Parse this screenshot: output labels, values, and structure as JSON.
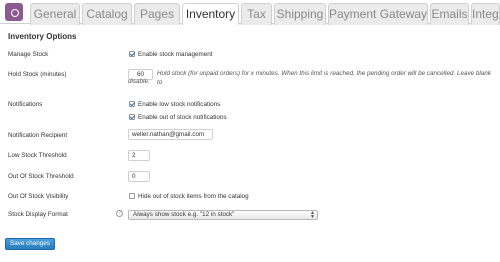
{
  "tabs": [
    {
      "label": "General",
      "active": false
    },
    {
      "label": "Catalog",
      "active": false
    },
    {
      "label": "Pages",
      "active": false
    },
    {
      "label": "Inventory",
      "active": true
    },
    {
      "label": "Tax",
      "active": false
    },
    {
      "label": "Shipping",
      "active": false
    },
    {
      "label": "Payment Gateways",
      "active": false
    },
    {
      "label": "Emails",
      "active": false
    },
    {
      "label": "Integration",
      "active": false
    }
  ],
  "section_title": "Inventory Options",
  "manage_stock": {
    "label": "Manage Stock",
    "checkbox_label": "Enable stock management",
    "checked": true
  },
  "hold_stock": {
    "label": "Hold Stock (minutes)",
    "value": "60",
    "description": "Hold stock (for unpaid orders) for x minutes. When this limit is reached, the pending order will be cancelled. Leave blank to",
    "description_cont": "disable."
  },
  "notifications": {
    "label": "Notifications",
    "low_stock_label": "Enable low stock notifications",
    "low_stock_checked": true,
    "out_of_stock_label": "Enable out of stock notifications",
    "out_of_stock_checked": true
  },
  "notification_recipient": {
    "label": "Notification Recipient",
    "value": "weller.nathan@gmail.com"
  },
  "low_stock_threshold": {
    "label": "Low Stock Threshold",
    "value": "2"
  },
  "out_of_stock_threshold": {
    "label": "Out Of Stock Threshold",
    "value": "0"
  },
  "out_of_stock_visibility": {
    "label": "Out Of Stock Visibility",
    "checkbox_label": "Hide out of stock items from the catalog",
    "checked": false
  },
  "stock_display_format": {
    "label": "Stock Display Format",
    "help": "?",
    "selected": "Always show stock e.g. \"12 in stock\""
  },
  "save_button": "Save changes",
  "colors": {
    "accent": "#2b7dbd",
    "logo": "#8b5a8f",
    "tab_inactive": "#ebebeb"
  }
}
